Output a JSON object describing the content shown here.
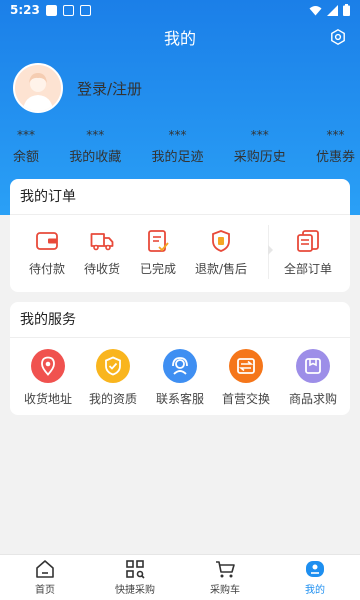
{
  "status_bar": {
    "time": "5:23"
  },
  "header": {
    "title": "我的"
  },
  "profile": {
    "login_label": "登录/注册"
  },
  "stats": [
    {
      "value": "***",
      "label": "余额"
    },
    {
      "value": "***",
      "label": "我的收藏"
    },
    {
      "value": "***",
      "label": "我的足迹"
    },
    {
      "value": "***",
      "label": "采购历史"
    },
    {
      "value": "***",
      "label": "优惠券"
    }
  ],
  "orders": {
    "title": "我的订单",
    "items": [
      {
        "label": "待付款",
        "icon": "wallet-icon"
      },
      {
        "label": "待收货",
        "icon": "truck-icon"
      },
      {
        "label": "已完成",
        "icon": "clipboard-check-icon"
      },
      {
        "label": "退款/售后",
        "icon": "refund-shield-icon"
      },
      {
        "label": "全部订单",
        "icon": "order-list-icon"
      }
    ]
  },
  "services": {
    "title": "我的服务",
    "items": [
      {
        "label": "收货地址",
        "icon": "location-pin-icon"
      },
      {
        "label": "我的资质",
        "icon": "shield-check-icon"
      },
      {
        "label": "联系客服",
        "icon": "headset-icon"
      },
      {
        "label": "首营交换",
        "icon": "exchange-icon"
      },
      {
        "label": "商品求购",
        "icon": "box-icon"
      }
    ]
  },
  "bottom_nav": [
    {
      "label": "首页",
      "icon": "home-icon"
    },
    {
      "label": "快捷采购",
      "icon": "qr-scan-icon"
    },
    {
      "label": "采购车",
      "icon": "cart-icon"
    },
    {
      "label": "我的",
      "icon": "profile-icon"
    }
  ],
  "colors": {
    "primary": "#1e8ff0",
    "order_icon": "#e84a3a",
    "service_address": "#f0524f",
    "service_qualification": "#f9b51e",
    "service_support": "#3f8ff2",
    "service_exchange": "#f5761a",
    "service_purchase": "#9d8ee8"
  }
}
